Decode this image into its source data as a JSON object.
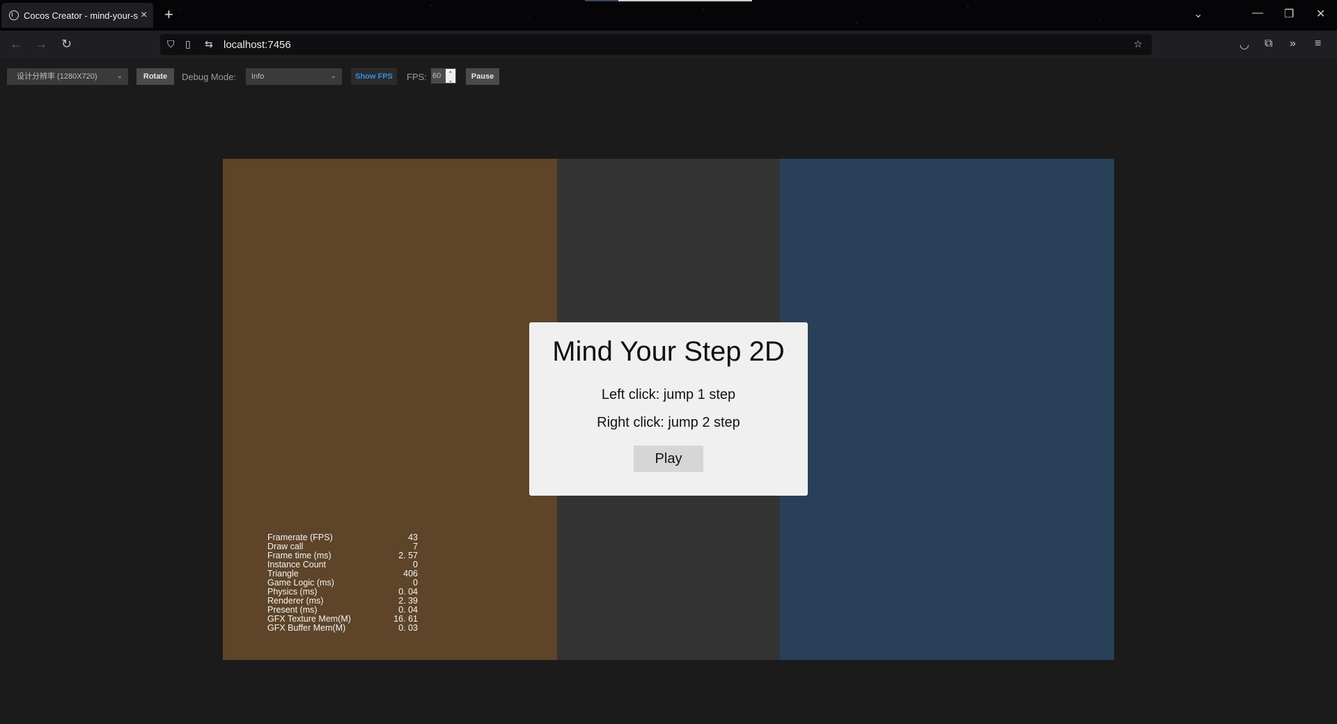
{
  "browser": {
    "tab_title": "Cocos Creator - mind-your-s",
    "tab_close": "×",
    "new_tab": "+",
    "url": "localhost:7456"
  },
  "toolbar": {
    "resolution_select": "设计分辨率 (1280X720)",
    "rotate_label": "Rotate",
    "debug_mode_label": "Debug Mode:",
    "debug_mode_value": "Info",
    "show_fps_label": "Show FPS",
    "fps_label": "FPS:",
    "fps_value": "60",
    "pause_label": "Pause"
  },
  "game": {
    "colors": {
      "left": "#5e4429",
      "middle": "#333333",
      "right": "#284058"
    },
    "menu": {
      "title": "Mind Your Step 2D",
      "line1": "Left click: jump 1 step",
      "line2": "Right click: jump 2 step",
      "play_label": "Play"
    },
    "stats": [
      {
        "label": "Framerate (FPS)",
        "value": "43"
      },
      {
        "label": "Draw call",
        "value": "7"
      },
      {
        "label": "Frame time (ms)",
        "value": "2. 57"
      },
      {
        "label": "Instance Count",
        "value": "0"
      },
      {
        "label": "Triangle",
        "value": "406"
      },
      {
        "label": "Game Logic (ms)",
        "value": "0"
      },
      {
        "label": "Physics (ms)",
        "value": "0. 04"
      },
      {
        "label": "Renderer (ms)",
        "value": "2. 39"
      },
      {
        "label": "Present (ms)",
        "value": "0. 04"
      },
      {
        "label": "GFX Texture Mem(M)",
        "value": "16. 61"
      },
      {
        "label": "GFX Buffer Mem(M)",
        "value": "0. 03"
      }
    ]
  }
}
